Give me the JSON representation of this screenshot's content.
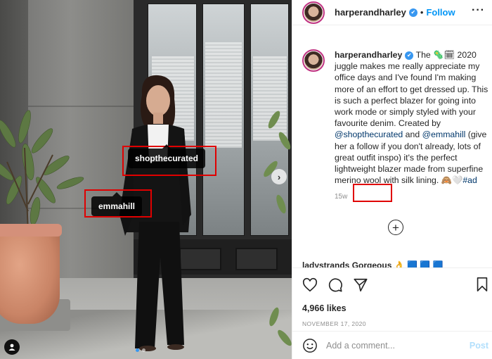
{
  "account": {
    "username": "harperandharley",
    "verified_badge": "✔",
    "separator": "•",
    "follow_label": "Follow",
    "more_label": "···"
  },
  "photo": {
    "tags": [
      {
        "label": "shopthecurated"
      },
      {
        "label": "emmahill"
      }
    ],
    "next_arrow": "›",
    "carousel_dots": 2
  },
  "caption": {
    "username": "harperandharley",
    "text_1": " The ",
    "emoji_1": "🦠🗓",
    "text_2": " 2020 juggle makes me really appreciate my office days and I've found I'm making more of an effort to get dressed up. This is such a perfect blazer for going into work mode or simply styled with your favourite denim. Created by ",
    "mention_1": "@shopthecurated",
    "text_3": " and ",
    "mention_2": "@emmahill",
    "text_4": " (give her a follow if you don't already, lots of great outfit inspo) it's the perfect lightweight blazer made from superfine merino wool with silk lining. ",
    "emoji_2": "🙈🤍",
    "hashtag": "#ad",
    "time_ago": "15w"
  },
  "load_more_label": "+",
  "comment_peek": "ladystrands Gorgeous 👌 🟦 🟦 🟦",
  "engagement": {
    "likes": "4,966 likes",
    "date": "NOVEMBER 17, 2020"
  },
  "comment_bar": {
    "placeholder": "Add a comment...",
    "post_label": "Post"
  },
  "colors": {
    "link_blue": "#0095f6",
    "verified_blue": "#3897f0",
    "highlight_red": "#e00000",
    "muted_gray": "#8e8e8e"
  }
}
